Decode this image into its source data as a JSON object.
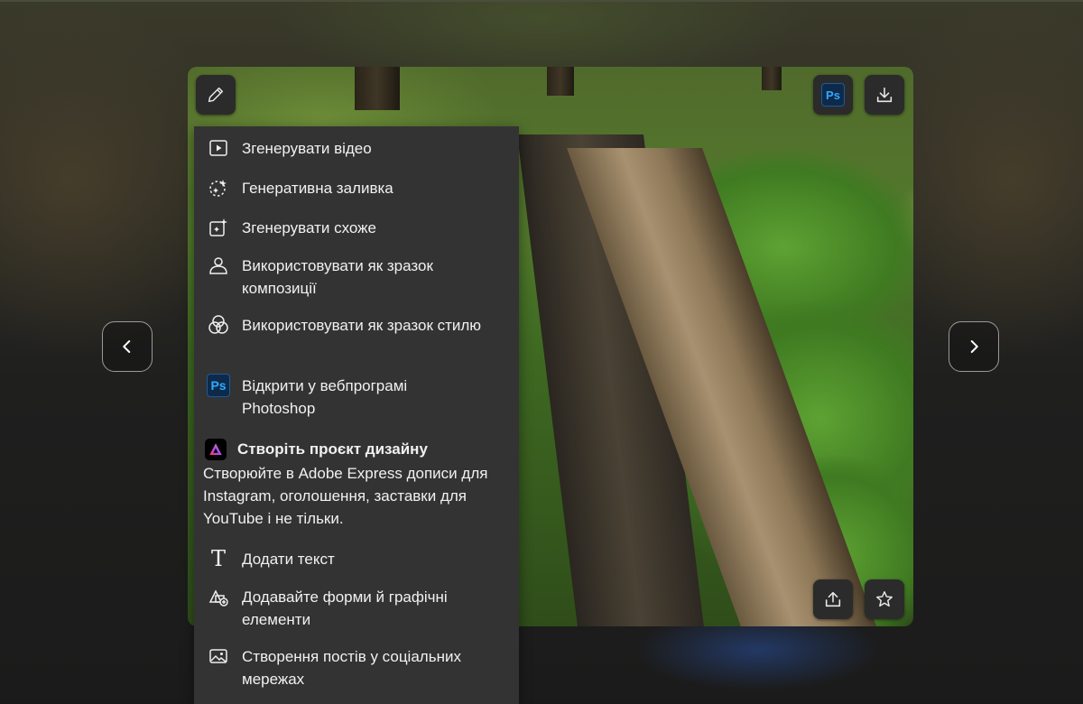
{
  "menu": {
    "items": [
      {
        "label": "Згенерувати відео",
        "icon": "video-icon"
      },
      {
        "label": "Генеративна заливка",
        "icon": "generative-fill-icon"
      },
      {
        "label": "Згенерувати схоже",
        "icon": "generate-similar-icon"
      },
      {
        "label": "Використовувати як зразок композиції",
        "icon": "person-reference-icon"
      },
      {
        "label": "Використовувати як зразок стилю",
        "icon": "style-reference-icon"
      },
      {
        "label": "Відкрити у вебпрограмі Photoshop",
        "icon": "photoshop-icon",
        "badge": "Ps"
      }
    ],
    "express": {
      "title": "Створіть проєкт дизайну",
      "description": "Створюйте в Adobe Express дописи для Instagram, оголошення, заставки для YouTube і не тільки."
    },
    "express_items": [
      {
        "label": "Додати текст",
        "icon": "text-icon"
      },
      {
        "label": "Додавайте форми й графічні елементи",
        "icon": "shapes-icon"
      },
      {
        "label": "Створення постів у соціальних мережах",
        "icon": "image-post-icon"
      }
    ]
  },
  "toolbar": {
    "ps_badge": "Ps"
  }
}
